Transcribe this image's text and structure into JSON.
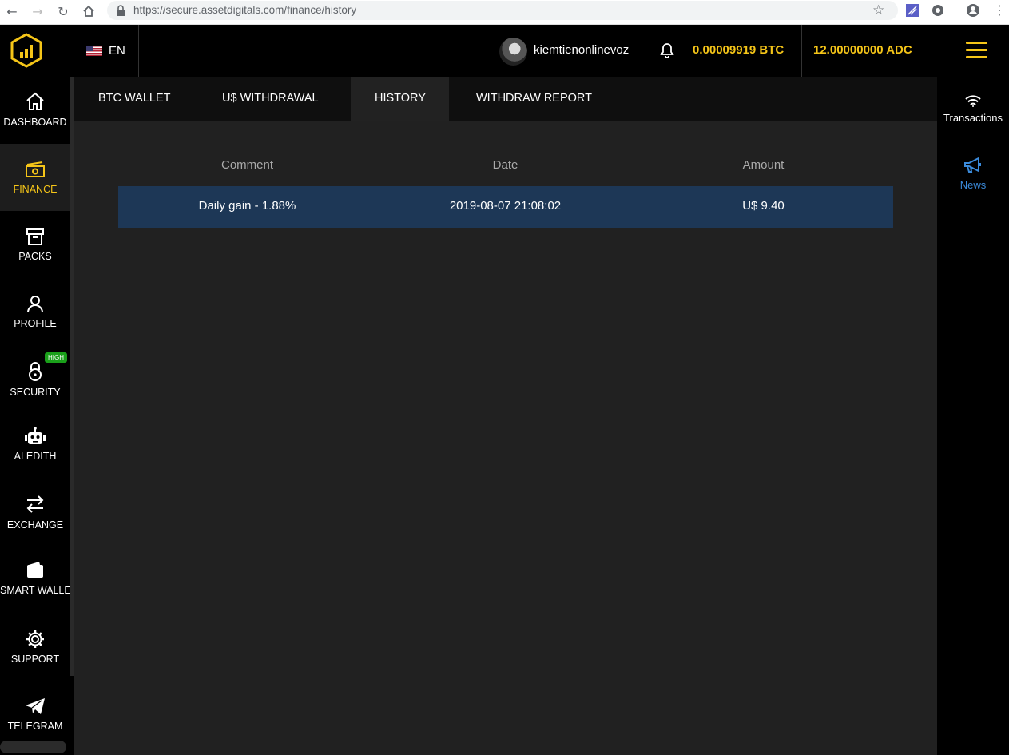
{
  "browser": {
    "url": "https://secure.assetdigitals.com/finance/history"
  },
  "header": {
    "language": "EN",
    "username": "kiemtienonlinevoz",
    "btc_balance": "0.00009919 BTC",
    "adc_balance": "12.00000000 ADC",
    "accent_color": "#f5c518"
  },
  "sidebar": {
    "items": [
      {
        "label": "DASHBOARD",
        "icon": "home-icon"
      },
      {
        "label": "FINANCE",
        "icon": "money-icon",
        "active": true
      },
      {
        "label": "PACKS",
        "icon": "archive-icon"
      },
      {
        "label": "PROFILE",
        "icon": "user-icon"
      },
      {
        "label": "SECURITY",
        "icon": "lock-icon",
        "badge": "HIGH"
      },
      {
        "label": "AI EDITH",
        "icon": "robot-icon"
      },
      {
        "label": "EXCHANGE",
        "icon": "exchange-icon"
      },
      {
        "label": "SMART WALLET",
        "icon": "wallet-icon"
      },
      {
        "label": "SUPPORT",
        "icon": "gear-icon"
      },
      {
        "label": "TELEGRAM",
        "icon": "telegram-icon"
      }
    ]
  },
  "tabs": [
    {
      "label": "BTC WALLET"
    },
    {
      "label": "U$ WITHDRAWAL"
    },
    {
      "label": "HISTORY",
      "active": true
    },
    {
      "label": "WITHDRAW REPORT"
    }
  ],
  "history_table": {
    "columns": [
      "Comment",
      "Date",
      "Amount"
    ],
    "rows": [
      {
        "comment": "Daily gain - 1.88%",
        "date": "2019-08-07 21:08:02",
        "amount": "U$ 9.40"
      }
    ],
    "row_color": "#1d3756"
  },
  "rightbar": {
    "items": [
      {
        "label": "Transactions",
        "icon": "wifi-icon"
      },
      {
        "label": "News",
        "icon": "megaphone-icon",
        "color": "#3b8bdb"
      }
    ]
  }
}
